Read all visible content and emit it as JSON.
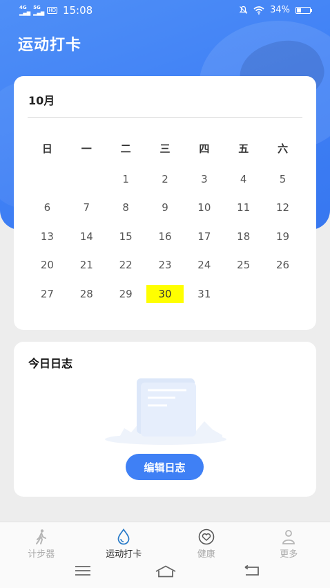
{
  "status_bar": {
    "net1": "4G",
    "net2": "5G",
    "hd": "HD",
    "time": "15:08",
    "battery": "34%",
    "battery_level": 0.34
  },
  "header": {
    "title": "运动打卡"
  },
  "calendar": {
    "month": "10月",
    "weekdays": [
      "日",
      "一",
      "二",
      "三",
      "四",
      "五",
      "六"
    ],
    "leading_blanks": 2,
    "days": [
      "1",
      "2",
      "3",
      "4",
      "5",
      "6",
      "7",
      "8",
      "9",
      "10",
      "11",
      "12",
      "13",
      "14",
      "15",
      "16",
      "17",
      "18",
      "19",
      "20",
      "21",
      "22",
      "23",
      "24",
      "25",
      "26",
      "27",
      "28",
      "29",
      "30",
      "31"
    ],
    "highlighted_day": "30",
    "highlight_color": "#ffff00"
  },
  "log": {
    "title": "今日日志",
    "edit_button": "编辑日志"
  },
  "tabbar": {
    "items": [
      {
        "label": "计步器",
        "icon": "walker-icon",
        "active": false
      },
      {
        "label": "运动打卡",
        "icon": "water-drop-icon",
        "active": true
      },
      {
        "label": "健康",
        "icon": "heart-icon",
        "active": false
      },
      {
        "label": "更多",
        "icon": "person-icon",
        "active": false
      }
    ]
  },
  "navbar": {
    "icons": [
      "menu-icon",
      "home-icon",
      "back-icon"
    ]
  },
  "colors": {
    "accent": "#3f80f5",
    "background": "#ededed"
  }
}
